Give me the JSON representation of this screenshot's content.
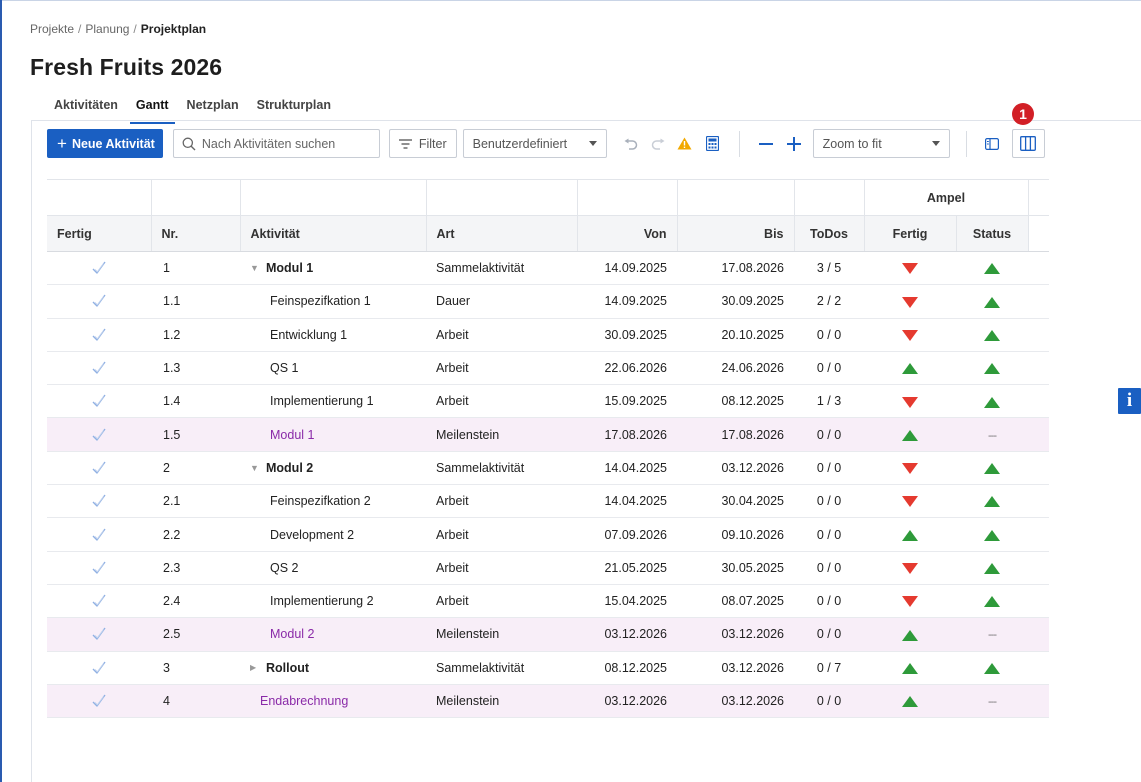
{
  "breadcrumb": [
    "Projekte",
    "Planung",
    "Projektplan"
  ],
  "page_title": "Fresh Fruits 2026",
  "tabs": [
    "Aktivitäten",
    "Gantt",
    "Netzplan",
    "Strukturplan"
  ],
  "active_tab": "Gantt",
  "toolbar": {
    "new_activity_label": "Neue Aktivität",
    "search_placeholder": "Nach Aktivitäten suchen",
    "filter_label": "Filter",
    "view_select": "Benutzerdefiniert",
    "zoom_select": "Zoom to fit"
  },
  "badge_number": "1",
  "info_label": "i",
  "table": {
    "group_header": "Ampel",
    "columns": [
      "Fertig",
      "Nr.",
      "Aktivität",
      "Art",
      "Von",
      "Bis",
      "ToDos",
      "Fertig",
      "Status"
    ],
    "rows": [
      {
        "nr": "1",
        "activity": "Modul 1",
        "type": "Sammelaktivität",
        "from": "14.09.2025",
        "to": "17.08.2026",
        "todos": "3 / 5",
        "fertig": "down",
        "status": "up",
        "kind": "summary",
        "toggle": "expanded"
      },
      {
        "nr": "1.1",
        "activity": "Feinspezifkation 1",
        "type": "Dauer",
        "from": "14.09.2025",
        "to": "30.09.2025",
        "todos": "2 / 2",
        "fertig": "down",
        "status": "up",
        "kind": "task"
      },
      {
        "nr": "1.2",
        "activity": "Entwicklung 1",
        "type": "Arbeit",
        "from": "30.09.2025",
        "to": "20.10.2025",
        "todos": "0 / 0",
        "fertig": "down",
        "status": "up",
        "kind": "task"
      },
      {
        "nr": "1.3",
        "activity": "QS 1",
        "type": "Arbeit",
        "from": "22.06.2026",
        "to": "24.06.2026",
        "todos": "0 / 0",
        "fertig": "up",
        "status": "up",
        "kind": "task"
      },
      {
        "nr": "1.4",
        "activity": "Implementierung 1",
        "type": "Arbeit",
        "from": "15.09.2025",
        "to": "08.12.2025",
        "todos": "1 / 3",
        "fertig": "down",
        "status": "up",
        "kind": "task"
      },
      {
        "nr": "1.5",
        "activity": "Modul 1",
        "type": "Meilenstein",
        "from": "17.08.2026",
        "to": "17.08.2026",
        "todos": "0 / 0",
        "fertig": "up",
        "status": "---",
        "kind": "milestone"
      },
      {
        "nr": "2",
        "activity": "Modul 2",
        "type": "Sammelaktivität",
        "from": "14.04.2025",
        "to": "03.12.2026",
        "todos": "0 / 0",
        "fertig": "down",
        "status": "up",
        "kind": "summary",
        "toggle": "expanded"
      },
      {
        "nr": "2.1",
        "activity": "Feinspezifkation 2",
        "type": "Arbeit",
        "from": "14.04.2025",
        "to": "30.04.2025",
        "todos": "0 / 0",
        "fertig": "down",
        "status": "up",
        "kind": "task"
      },
      {
        "nr": "2.2",
        "activity": "Development 2",
        "type": "Arbeit",
        "from": "07.09.2026",
        "to": "09.10.2026",
        "todos": "0 / 0",
        "fertig": "up",
        "status": "up",
        "kind": "task"
      },
      {
        "nr": "2.3",
        "activity": "QS 2",
        "type": "Arbeit",
        "from": "21.05.2025",
        "to": "30.05.2025",
        "todos": "0 / 0",
        "fertig": "down",
        "status": "up",
        "kind": "task"
      },
      {
        "nr": "2.4",
        "activity": "Implementierung 2",
        "type": "Arbeit",
        "from": "15.04.2025",
        "to": "08.07.2025",
        "todos": "0 / 0",
        "fertig": "down",
        "status": "up",
        "kind": "task"
      },
      {
        "nr": "2.5",
        "activity": "Modul 2",
        "type": "Meilenstein",
        "from": "03.12.2026",
        "to": "03.12.2026",
        "todos": "0 / 0",
        "fertig": "up",
        "status": "---",
        "kind": "milestone"
      },
      {
        "nr": "3",
        "activity": "Rollout",
        "type": "Sammelaktivität",
        "from": "08.12.2025",
        "to": "03.12.2026",
        "todos": "0 / 7",
        "fertig": "up",
        "status": "up",
        "kind": "summary",
        "toggle": "collapsed"
      },
      {
        "nr": "4",
        "activity": "Endabrechnung",
        "type": "Meilenstein",
        "from": "03.12.2026",
        "to": "03.12.2026",
        "todos": "0 / 0",
        "fertig": "up",
        "status": "---",
        "kind": "milestone-top"
      }
    ]
  },
  "colors": {
    "primary": "#1a5fc2",
    "red_indicator": "#e53a2f",
    "green_indicator": "#2e9a3a",
    "milestone_row_bg": "#f8eef8",
    "milestone_text": "#8a2aa8",
    "badge": "#d21f26"
  },
  "icons": {
    "done": "check-icon",
    "search": "search-icon",
    "filter": "filter-icon",
    "undo": "undo-icon",
    "redo": "redo-icon",
    "warning": "warning-icon",
    "calculator": "calculator-icon",
    "zoom_out": "minus-icon",
    "zoom_in": "plus-icon",
    "panel": "panel-icon",
    "columns": "columns-icon"
  }
}
